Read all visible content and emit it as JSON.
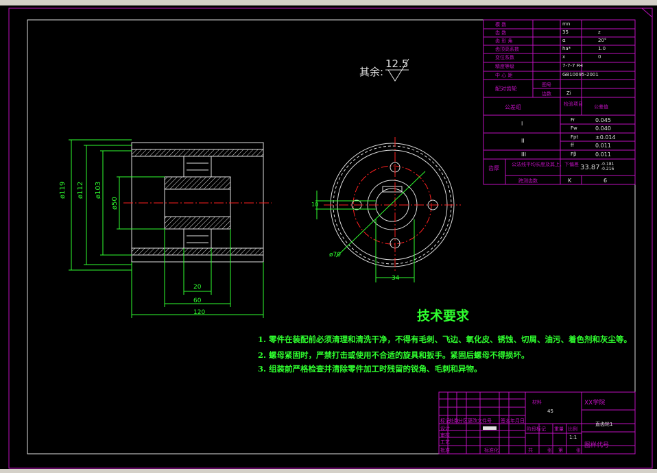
{
  "window": {
    "title": ""
  },
  "roughness": {
    "label": "其余:",
    "value": "12.5"
  },
  "tech_req": {
    "title": "技术要求",
    "items": [
      "1. 零件在装配前必须清理和清洗干净，不得有毛刺、飞边、氧化皮、锈蚀、切屑、油污、着色剂和灰尘等。",
      "2. 螺母紧固时，严禁打击或使用不合适的旋具和扳手。紧固后螺母不得损坏。",
      "3. 组装前严格检查并清除零件加工时残留的锐角、毛刺和异物。"
    ]
  },
  "dims": {
    "d119": "ø119",
    "d112": "ø112",
    "d103": "ø103",
    "d50": "ø50",
    "w20": "20",
    "w60": "60",
    "w120": "120",
    "d70": "ø70",
    "h10": "10",
    "w34": "34"
  },
  "param_table": {
    "rows": [
      [
        "模    数",
        "mn",
        ""
      ],
      [
        "齿    数",
        "35",
        "z"
      ],
      [
        "齿 形 角",
        "α",
        "20°"
      ],
      [
        "齿顶高系数",
        "ha*",
        "1.0"
      ],
      [
        "变位系数",
        "x",
        "0"
      ],
      [
        "精度等级",
        "7-7-7 FH",
        ""
      ],
      [
        "中  心  距",
        "GB10095-2001",
        ""
      ]
    ],
    "mating_gear": "配对齿轮",
    "mating_sub": [
      "图号",
      "齿数",
      "Zi"
    ],
    "tolerance_group": "公差组",
    "check_items": "检验项目",
    "tolerance_value": "公差值",
    "groups": [
      {
        "name": "I",
        "items": [
          [
            "Fr",
            "0.045"
          ],
          [
            "Fw",
            "0.040"
          ]
        ]
      },
      {
        "name": "II",
        "items": [
          [
            "Fpt",
            "±0.014"
          ],
          [
            "ff",
            "0.011"
          ]
        ]
      },
      {
        "name": "III",
        "items": [
          [
            "Fβ",
            "0.011"
          ]
        ]
      }
    ],
    "thickness_label": "齿厚",
    "span_label": "公法线平均长度及其上、下偏差",
    "span_value": "33.87",
    "span_dev_upper": "-0.181",
    "span_dev_lower": "-0.216",
    "span_count_label": "跨测齿数",
    "span_k": "K",
    "span_count": "6"
  },
  "title_block": {
    "material_label": "材料",
    "material": "45",
    "school": "XX学院",
    "part_name": "直齿轮1",
    "scale_label_a": "阶段标记",
    "scale_label_b": "重量",
    "scale_label_c": "比例",
    "scale": "1:1",
    "drawing_no": "图样代号",
    "row_labels": [
      "标记",
      "处数",
      "分区",
      "更改文件号",
      "签名",
      "年月日"
    ],
    "left_labels": [
      "设计",
      "审核",
      "工艺",
      "批准"
    ],
    "sheet": [
      "共",
      "张",
      "第",
      "张"
    ],
    "standard": "标准化"
  }
}
